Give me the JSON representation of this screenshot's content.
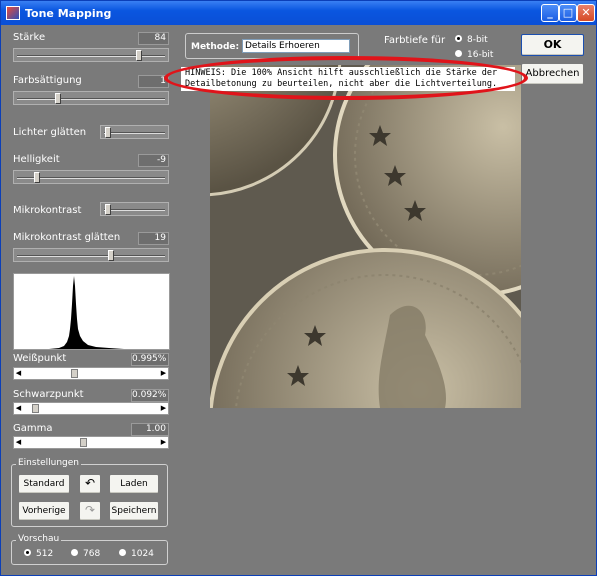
{
  "window": {
    "title": "Tone Mapping"
  },
  "titlebar_buttons": {
    "minimize": "_",
    "maximize": "□",
    "close": "✕"
  },
  "controls": {
    "staerke": {
      "label": "Stärke",
      "value": "84",
      "level": 0.84
    },
    "farbsaettigung": {
      "label": "Farbsättigung",
      "value": "1",
      "level": 0.27
    },
    "lichter_glaetten": {
      "label": "Lichter glätten",
      "level": 0.02
    },
    "helligkeit": {
      "label": "Helligkeit",
      "value": "-9",
      "level": 0.12
    },
    "mikrokontrast": {
      "label": "Mikrokontrast",
      "level": 0.02
    },
    "mikrokontrast_glaetten": {
      "label": "Mikrokontrast glätten",
      "value": "19",
      "level": 0.64
    }
  },
  "levels": {
    "weisspunkt": {
      "label": "Weißpunkt",
      "value": "0.995%",
      "level": 0.37
    },
    "schwarzpunkt": {
      "label": "Schwarzpunkt",
      "value": "0.092%",
      "level": 0.06
    },
    "gamma": {
      "label": "Gamma",
      "value": "1.00",
      "level": 0.44
    }
  },
  "einstellungen": {
    "label": "Einstellungen",
    "standard": "Standard",
    "laden": "Laden",
    "vorherige": "Vorherige",
    "speichern": "Speichern"
  },
  "vorschau": {
    "label": "Vorschau",
    "options": [
      "512",
      "768",
      "1024"
    ],
    "selected": "512"
  },
  "methode": {
    "label": "Methode:",
    "value": "Details Erhoeren"
  },
  "farbtiefe": {
    "label": "Farbtiefe für",
    "options": [
      "8-bit",
      "16-bit"
    ],
    "selected": "8-bit"
  },
  "buttons": {
    "ok": "OK",
    "abbrechen": "Abbrechen"
  },
  "hinweis": {
    "line1": "HINWEIS: Die 100% Ansicht hilft ausschließlich die Stärke der",
    "line2": "Detailbetonung zu beurteilen, nicht aber die Lichtverteilung."
  },
  "colors": {
    "window_bg": "#7a7a7a",
    "titlebar": "#0a56e0",
    "highlight": "#e0141a"
  }
}
